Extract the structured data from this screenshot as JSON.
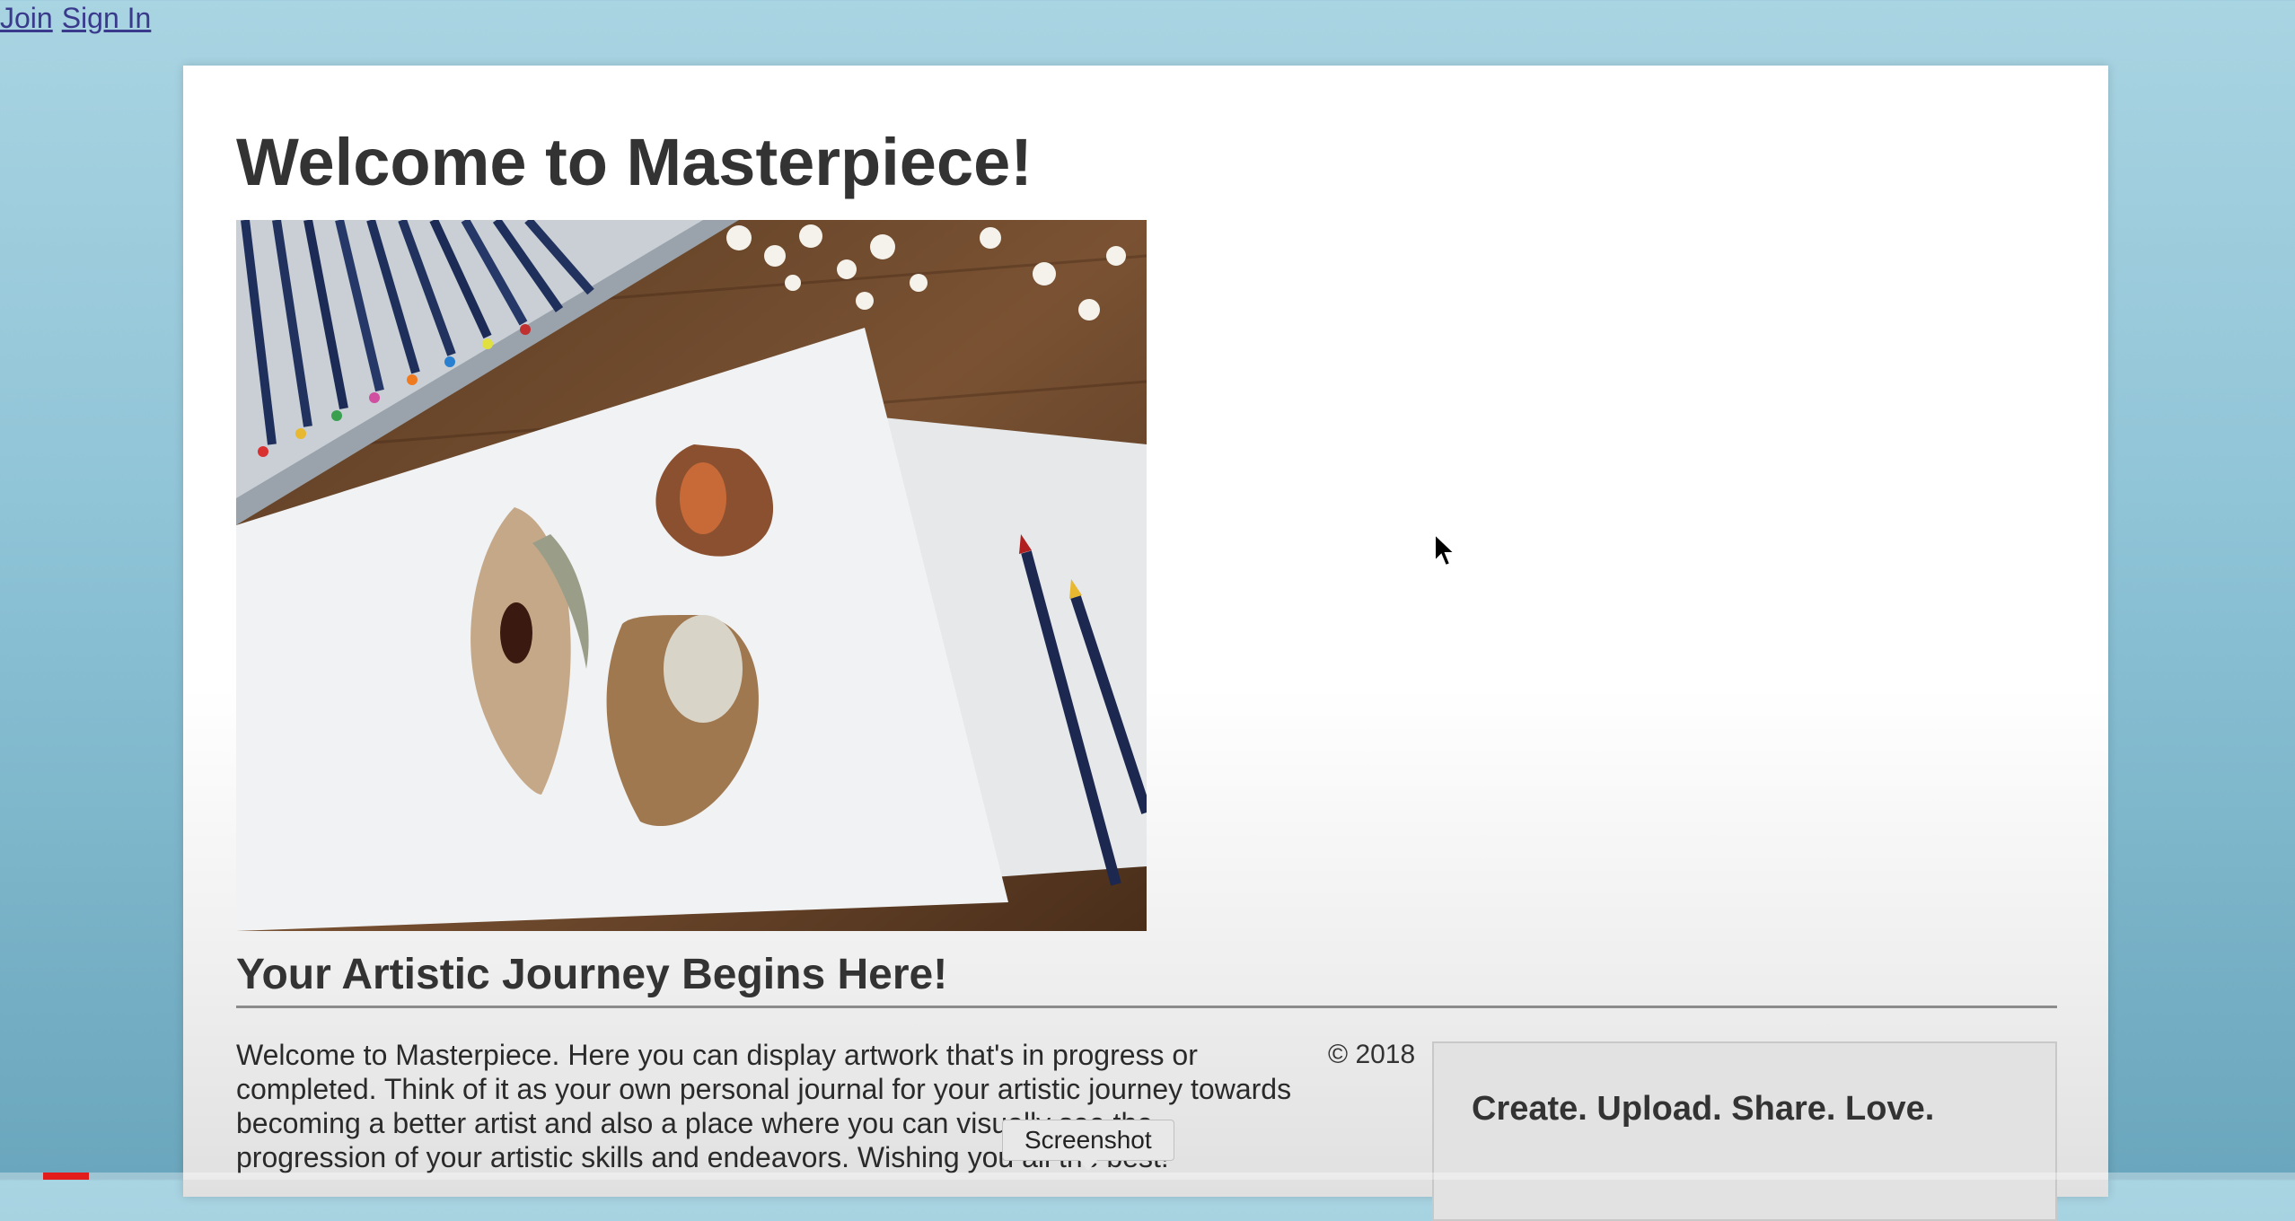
{
  "nav": {
    "join": "Join",
    "sign_in": "Sign In"
  },
  "page": {
    "title": "Welcome to Masterpiece!",
    "hero_image_alt": "Drawing of seashells on paper with colored pencils on a wooden desk",
    "subtitle": "Your Artistic Journey Begins Here!",
    "intro": "Welcome to Masterpiece. Here you can display artwork that's in progress or completed. Think of it as your own personal journal for your artistic journey towards becoming a better artist and also a place where you can visually see the progression of your artistic skills and endeavors. Wishing you all the best!",
    "copyright": "© 2018",
    "cta": "Create. Upload. Share. Love."
  },
  "tooltip": "Screenshot",
  "video_progress": 0.02,
  "colors": {
    "background_top": "#a9d4e2",
    "link": "#3a3a8c",
    "progress_red": "#e21b1b"
  },
  "icons": [
    "mouse-cursor-icon"
  ]
}
